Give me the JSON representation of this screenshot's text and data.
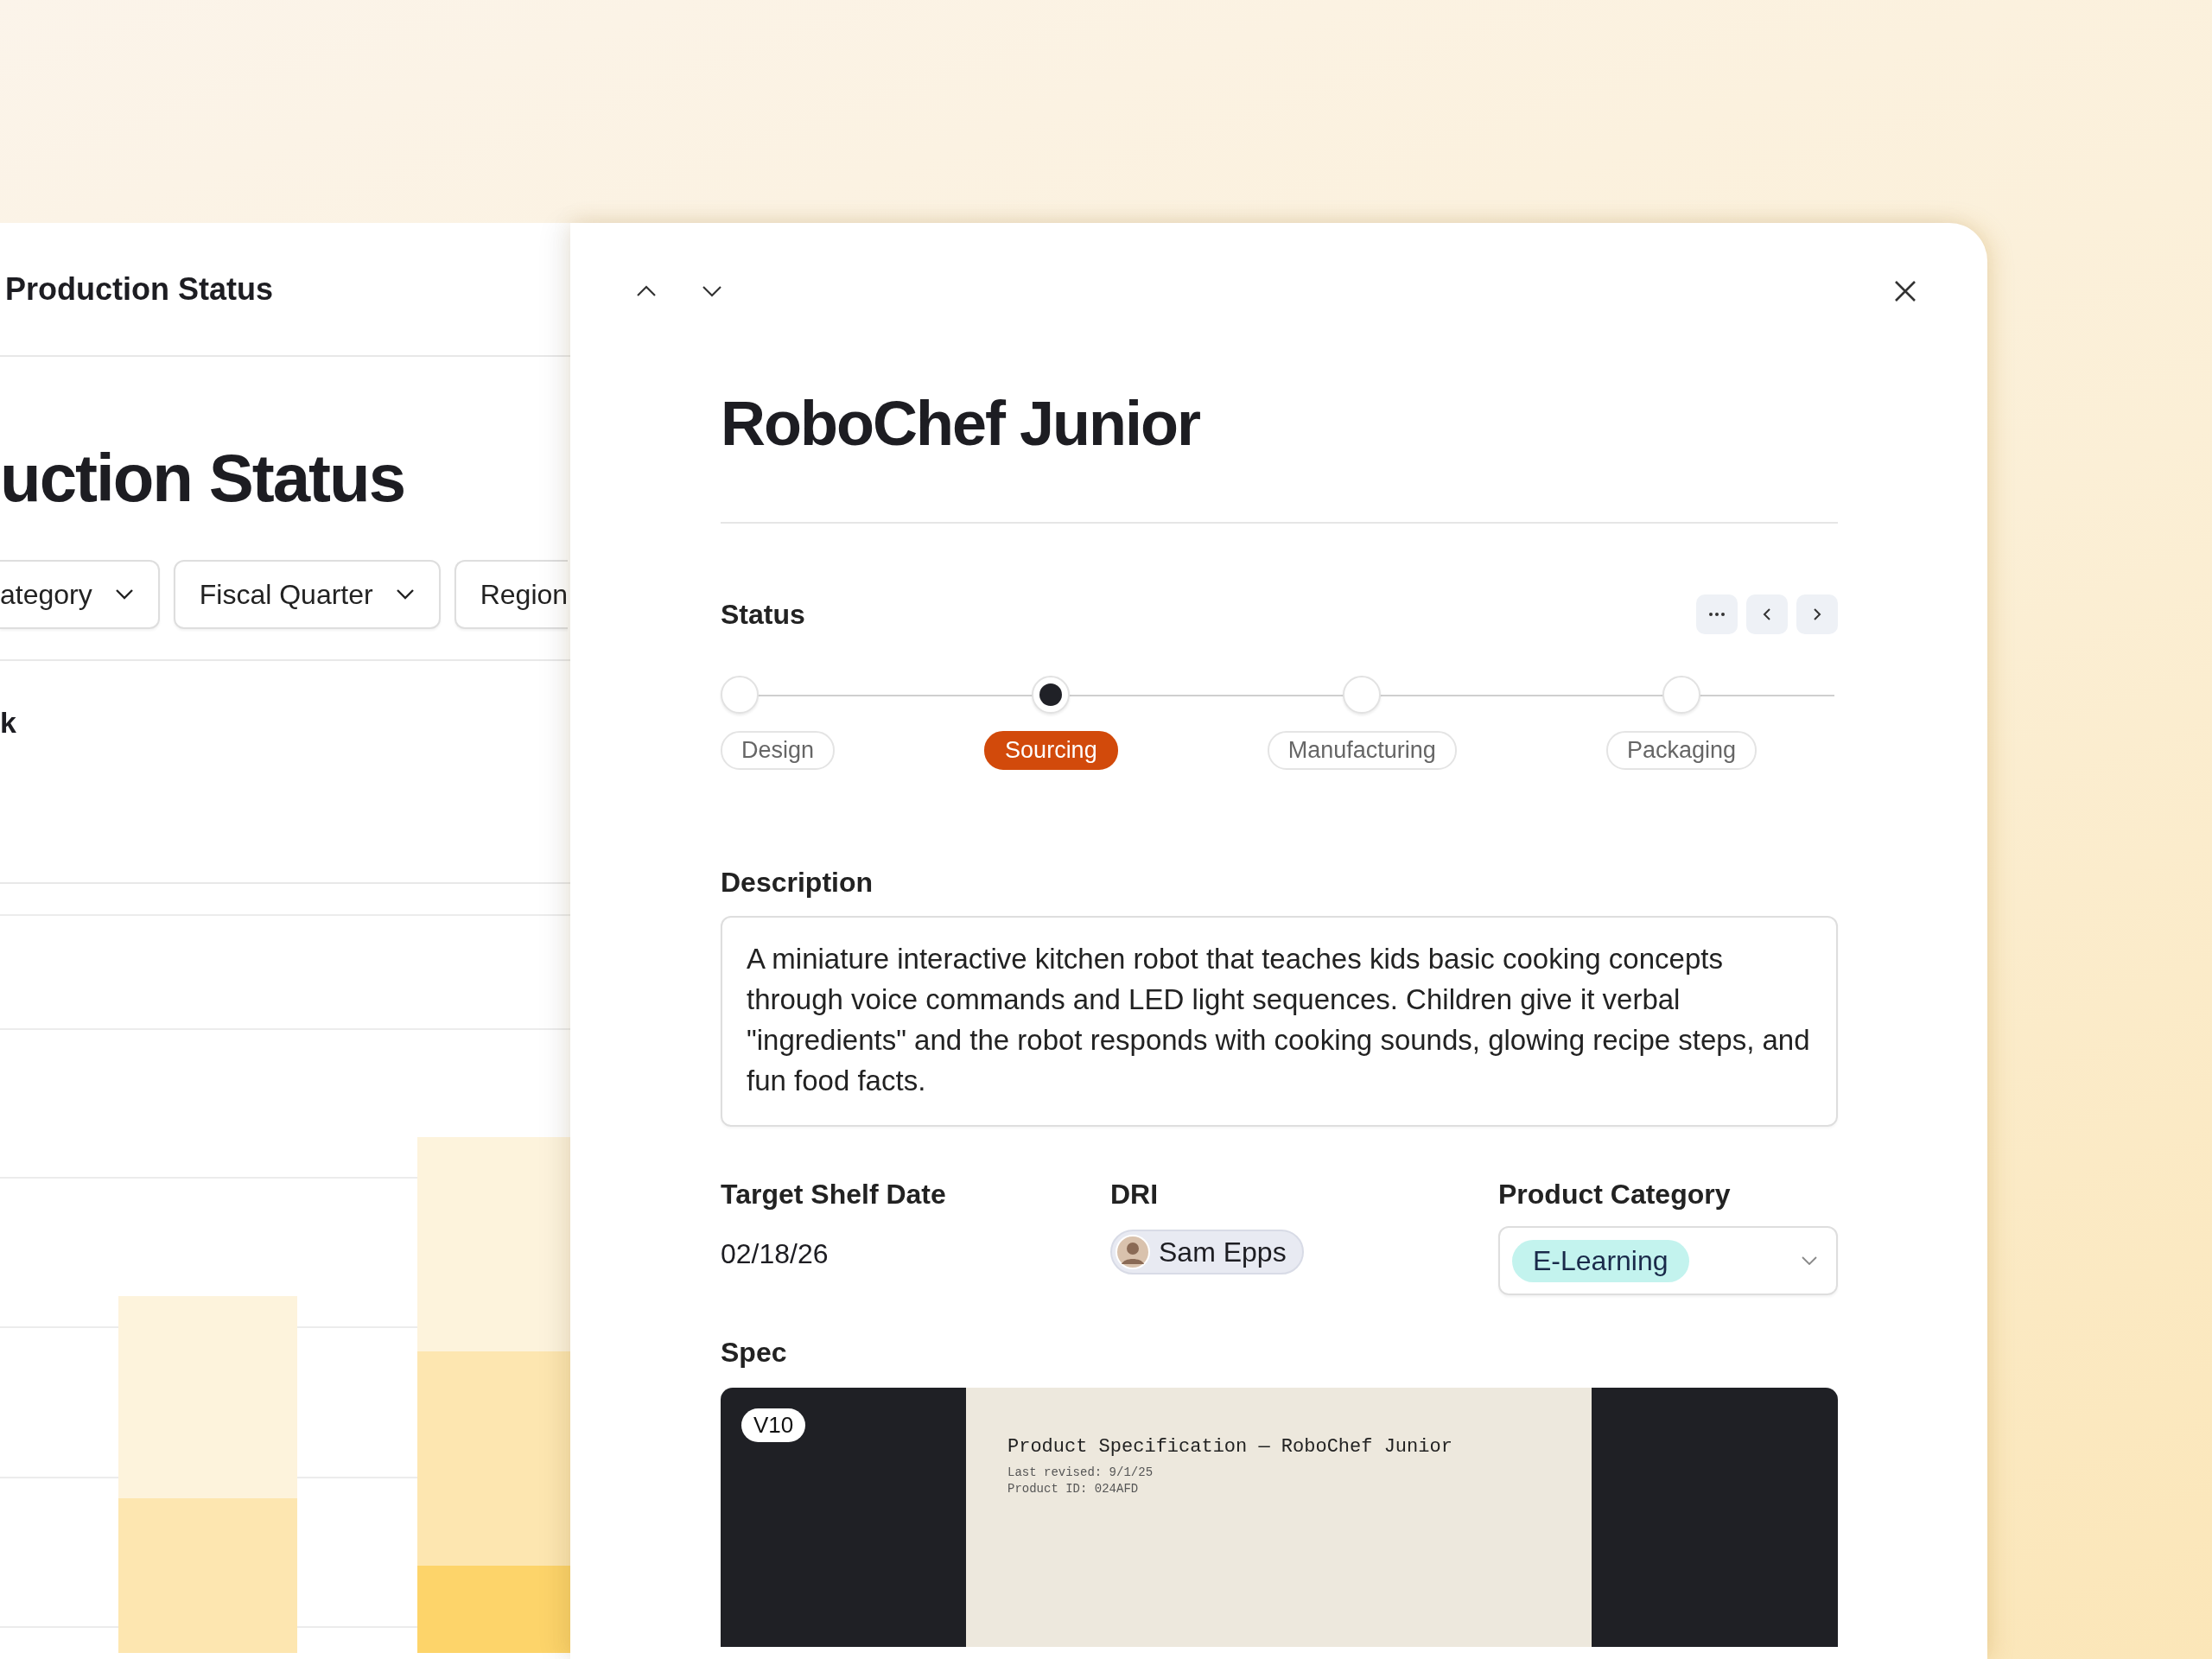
{
  "left_panel": {
    "header_title": "Production Status",
    "page_title": "uction Status",
    "filters": [
      {
        "label": "ategory",
        "caret": true
      },
      {
        "label": "Fiscal Quarter",
        "caret": true
      },
      {
        "label": "Region",
        "caret": false
      }
    ],
    "section_title": "k"
  },
  "detail": {
    "title": "RoboChef Junior",
    "status": {
      "label": "Status",
      "steps": [
        {
          "label": "Design",
          "selected": false
        },
        {
          "label": "Sourcing",
          "selected": true
        },
        {
          "label": "Manufacturing",
          "selected": false
        },
        {
          "label": "Packaging",
          "selected": false
        }
      ]
    },
    "description": {
      "label": "Description",
      "text": "A miniature interactive kitchen robot that teaches kids basic cooking concepts through voice commands and LED light sequences. Children give it verbal \"ingredients\" and the robot responds with cooking sounds, glowing recipe steps, and fun food facts."
    },
    "fields": [
      {
        "kind": "text",
        "label": "Target Shelf Date",
        "value": "02/18/26"
      },
      {
        "kind": "person",
        "label": "DRI",
        "value": "Sam Epps"
      },
      {
        "kind": "select",
        "label": "Product Category",
        "value": "E-Learning"
      }
    ],
    "spec": {
      "label": "Spec",
      "version": "V10",
      "doc_title": "Product Specification — RoboChef Junior",
      "doc_lines": [
        "Last revised: 9/1/25",
        "Product ID: 024AFD"
      ]
    }
  }
}
